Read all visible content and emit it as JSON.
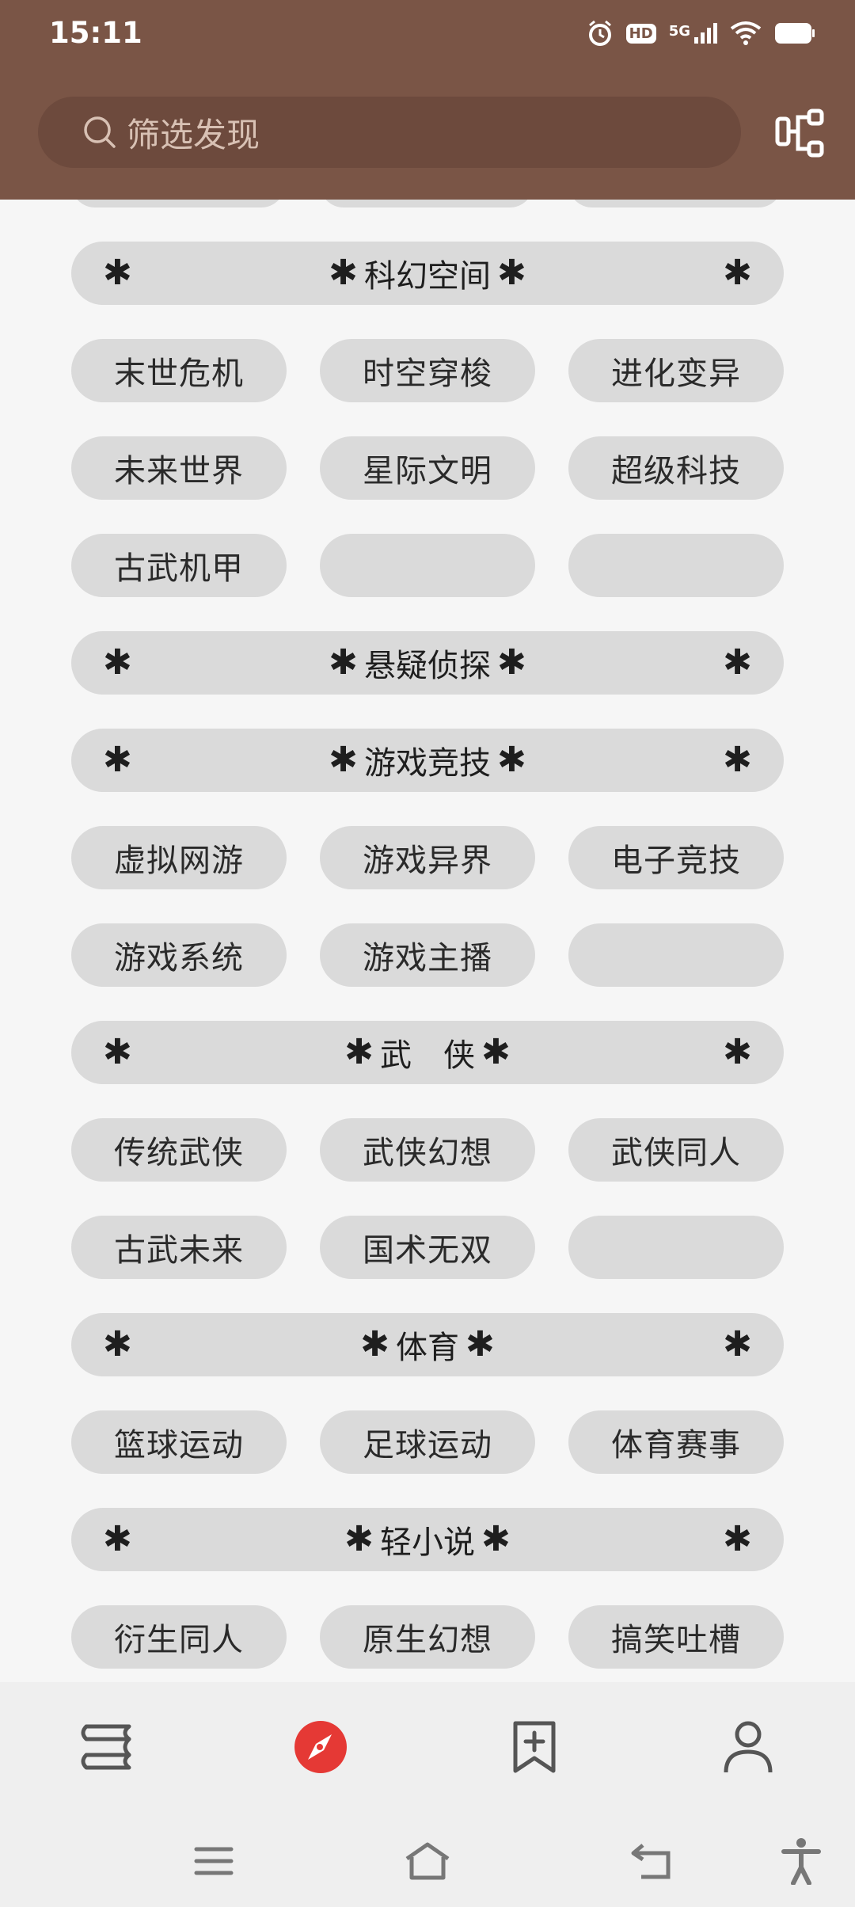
{
  "status": {
    "time": "15:11",
    "hd_badge": "HD",
    "network": "5G"
  },
  "search": {
    "placeholder": "筛选发现"
  },
  "sections": [
    {
      "type": "header",
      "title": "科幻空间"
    },
    {
      "type": "row",
      "items": [
        "末世危机",
        "时空穿梭",
        "进化变异"
      ]
    },
    {
      "type": "row",
      "items": [
        "未来世界",
        "星际文明",
        "超级科技"
      ]
    },
    {
      "type": "row",
      "items": [
        "古武机甲",
        "",
        ""
      ]
    },
    {
      "type": "header",
      "title": "悬疑侦探"
    },
    {
      "type": "header",
      "title": "游戏竞技"
    },
    {
      "type": "row",
      "items": [
        "虚拟网游",
        "游戏异界",
        "电子竞技"
      ]
    },
    {
      "type": "row",
      "items": [
        "游戏系统",
        "游戏主播",
        ""
      ]
    },
    {
      "type": "header",
      "title": "武　侠"
    },
    {
      "type": "row",
      "items": [
        "传统武侠",
        "武侠幻想",
        "武侠同人"
      ]
    },
    {
      "type": "row",
      "items": [
        "古武未来",
        "国术无双",
        ""
      ]
    },
    {
      "type": "header",
      "title": "体育"
    },
    {
      "type": "row",
      "items": [
        "篮球运动",
        "足球运动",
        "体育赛事"
      ]
    },
    {
      "type": "header",
      "title": "轻小说"
    },
    {
      "type": "row",
      "items": [
        "衍生同人",
        "原生幻想",
        "搞笑吐槽"
      ]
    }
  ],
  "star_glyph": "✱",
  "nav": {
    "items": [
      {
        "name": "bookshelf",
        "icon": "books-icon"
      },
      {
        "name": "discover",
        "icon": "compass-icon",
        "active": true
      },
      {
        "name": "bookmarks",
        "icon": "bookmark-add-icon"
      },
      {
        "name": "profile",
        "icon": "person-icon"
      }
    ],
    "active_color": "#e53935"
  },
  "colors": {
    "header_bg": "#7a5546",
    "pill_bg": "#dadada",
    "page_bg": "#f6f6f6"
  }
}
